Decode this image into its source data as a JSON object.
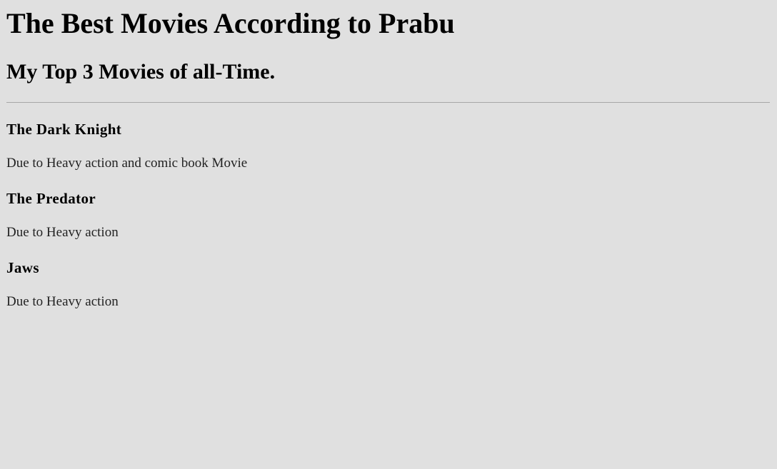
{
  "page": {
    "title": "The Best Movies According to Prabu",
    "subtitle": "My Top 3 Movies of all-Time."
  },
  "movies": [
    {
      "title": "The Dark Knight",
      "reason": "Due to Heavy action and comic book Movie"
    },
    {
      "title": "The Predator",
      "reason": "Due to Heavy action"
    },
    {
      "title": "Jaws",
      "reason": "Due to Heavy action"
    }
  ],
  "colors": {
    "background": "#e0e0e0",
    "text": "#000000",
    "divider": "#a8a8a8"
  }
}
